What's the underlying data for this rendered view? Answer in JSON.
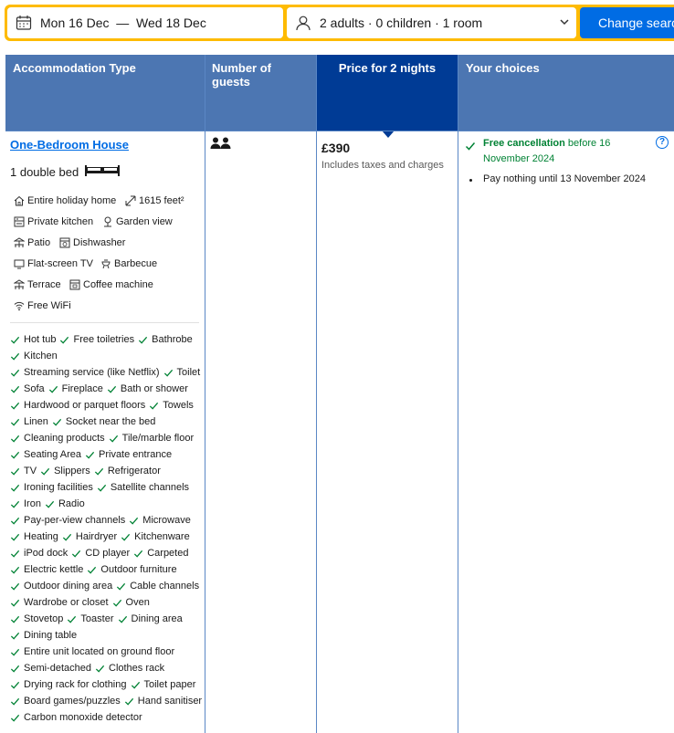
{
  "search": {
    "dates": "Mon 16 Dec  —  Wed 18 Dec",
    "guests": "2 adults · 0 children · 1 room",
    "button": "Change search"
  },
  "table": {
    "headers": [
      "Accommodation Type",
      "Number of guests",
      "Price for 2 nights",
      "Your choices"
    ]
  },
  "room": {
    "name": "One-Bedroom House",
    "bed": "1 double bed",
    "facilities": [
      {
        "icon": "house-icon",
        "label": "Entire holiday home"
      },
      {
        "icon": "size-icon",
        "label": "1615 feet²"
      },
      {
        "icon": "kitchen-icon",
        "label": "Private kitchen"
      },
      {
        "icon": "garden-icon",
        "label": "Garden view"
      },
      {
        "icon": "patio-icon",
        "label": "Patio"
      },
      {
        "icon": "dishwasher-icon",
        "label": "Dishwasher"
      },
      {
        "icon": "tv-icon",
        "label": "Flat-screen TV"
      },
      {
        "icon": "barbecue-icon",
        "label": "Barbecue"
      },
      {
        "icon": "terrace-icon",
        "label": "Terrace"
      },
      {
        "icon": "coffee-machine-icon",
        "label": "Coffee machine"
      },
      {
        "icon": "wifi-icon",
        "label": "Free WiFi"
      }
    ],
    "amenity_lines": [
      [
        "Hot tub",
        "Free toiletries",
        "Bathrobe"
      ],
      [
        "Kitchen"
      ],
      [
        "Streaming service (like Netflix)",
        "Toilet"
      ],
      [
        "Sofa",
        "Fireplace",
        "Bath or shower"
      ],
      [
        "Hardwood or parquet floors",
        "Towels"
      ],
      [
        "Linen",
        "Socket near the bed"
      ],
      [
        "Cleaning products",
        "Tile/marble floor"
      ],
      [
        "Seating Area",
        "Private entrance"
      ],
      [
        "TV",
        "Slippers",
        "Refrigerator"
      ],
      [
        "Ironing facilities",
        "Satellite channels"
      ],
      [
        "Iron",
        "Radio"
      ],
      [
        "Pay-per-view channels",
        "Microwave"
      ],
      [
        "Heating",
        "Hairdryer",
        "Kitchenware"
      ],
      [
        "iPod dock",
        "CD player",
        "Carpeted"
      ],
      [
        "Electric kettle",
        "Outdoor furniture"
      ],
      [
        "Outdoor dining area",
        "Cable channels"
      ],
      [
        "Wardrobe or closet",
        "Oven"
      ],
      [
        "Stovetop",
        "Toaster",
        "Dining area"
      ],
      [
        "Dining table"
      ],
      [
        "Entire unit located on ground floor"
      ],
      [
        "Semi-detached",
        "Clothes rack"
      ],
      [
        "Drying rack for clothing",
        "Toilet paper"
      ],
      [
        "Board games/puzzles",
        "Hand sanitiser"
      ],
      [
        "Carbon monoxide detector"
      ]
    ]
  },
  "guests_icon": "two-persons-icon",
  "price": {
    "amount": "£390",
    "note": "Includes taxes and charges"
  },
  "choices": {
    "cancel_bold": "Free cancellation",
    "cancel_rest": " before 16 November 2024",
    "pay": "Pay nothing until 13 November 2024"
  },
  "colors": {
    "accent": "#febb02",
    "primary": "#006ce4",
    "header": "#4c76b2",
    "header_selected": "#003b95",
    "success": "#008234"
  }
}
